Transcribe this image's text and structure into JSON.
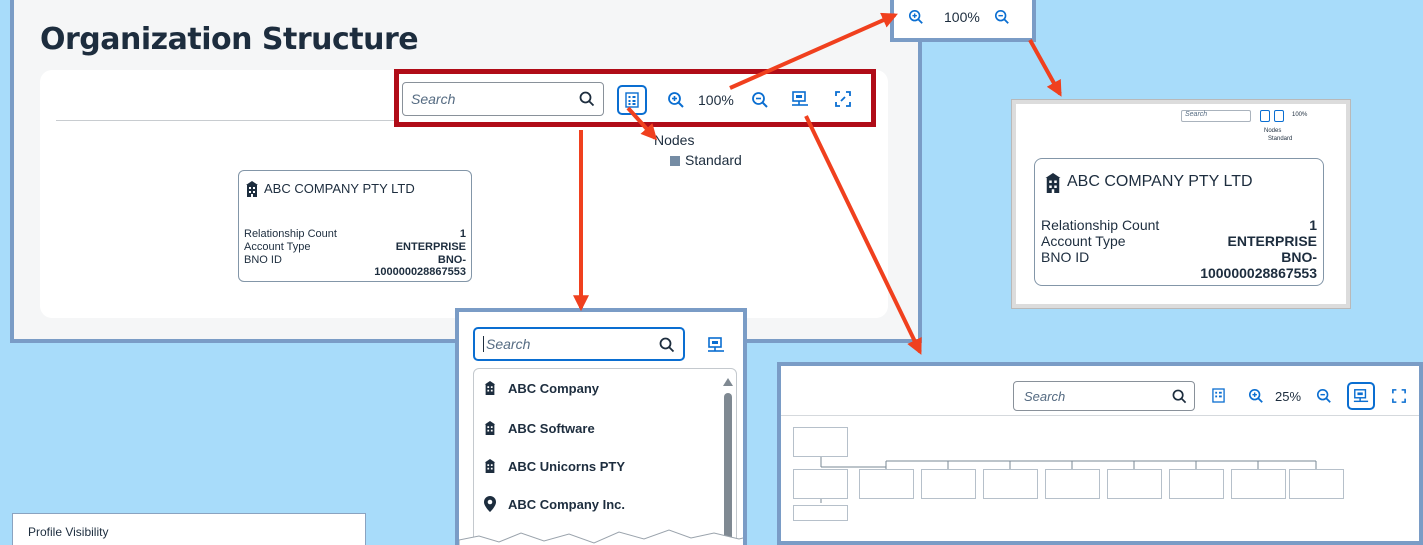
{
  "page": {
    "title": "Organization Structure"
  },
  "toolbar": {
    "search_placeholder": "Search",
    "zoom_level": "100%"
  },
  "legend": {
    "title": "Nodes",
    "items": [
      {
        "label": "Standard",
        "color": "#758ca4"
      }
    ]
  },
  "node": {
    "name": "ABC COMPANY PTY LTD",
    "fields": [
      {
        "label": "Relationship Count",
        "value": "1"
      },
      {
        "label": "Account Type",
        "value": "ENTERPRISE"
      },
      {
        "label": "BNO ID",
        "value": "BNO-"
      },
      {
        "label": "",
        "value": "100000028867553"
      }
    ]
  },
  "zoom_callout": {
    "zoom_level": "100%"
  },
  "search_callout": {
    "placeholder": "Search",
    "results": [
      {
        "label": "ABC Company",
        "icon": "building-icon"
      },
      {
        "label": "ABC Software",
        "icon": "building-icon"
      },
      {
        "label": "ABC Unicorns PTY",
        "icon": "building-icon"
      },
      {
        "label": "ABC Company Inc.",
        "icon": "location-pin-icon"
      }
    ]
  },
  "overview_callout": {
    "search_placeholder": "Search",
    "zoom_level": "25%"
  },
  "mini_callout": {
    "search_placeholder": "Search",
    "zoom_level": "100%",
    "legend_title": "Nodes",
    "legend_item": "Standard"
  },
  "bottom_panel": {
    "title": "Profile Visibility"
  },
  "colors": {
    "accent": "#0a6ed1",
    "highlight": "#b00c18",
    "arrow": "#f0401e",
    "frame": "#7a9cc6",
    "background": "#a8dcfa"
  }
}
